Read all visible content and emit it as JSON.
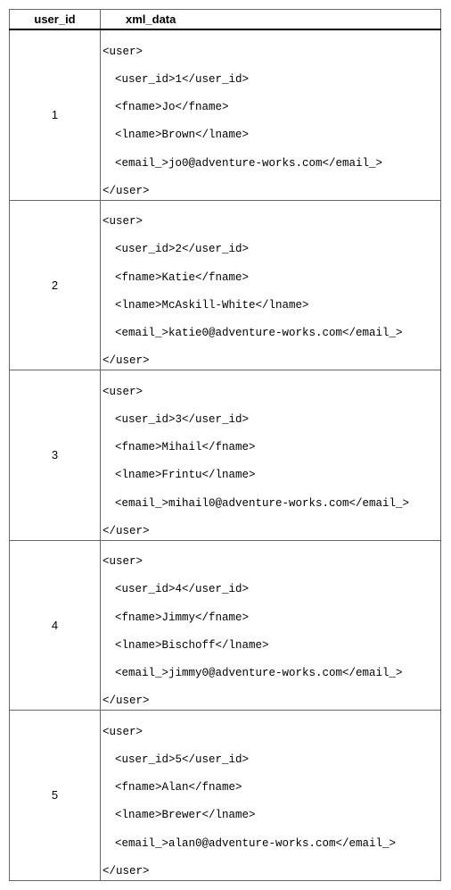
{
  "headers": {
    "user_id": "user_id",
    "xml_data": "xml_data"
  },
  "rows": [
    {
      "user_id": "1",
      "xml": {
        "open": "<user>",
        "user_id_line": "<user_id>1</user_id>",
        "fname_line": "<fname>Jo</fname>",
        "lname_line": "<lname>Brown</lname>",
        "email_line": "<email_>jo0@adventure-works.com</email_>",
        "close": "</user>"
      }
    },
    {
      "user_id": "2",
      "xml": {
        "open": "<user>",
        "user_id_line": "<user_id>2</user_id>",
        "fname_line": "<fname>Katie</fname>",
        "lname_line": "<lname>McAskill-White</lname>",
        "email_line": "<email_>katie0@adventure-works.com</email_>",
        "close": "</user>"
      }
    },
    {
      "user_id": "3",
      "xml": {
        "open": "<user>",
        "user_id_line": "<user_id>3</user_id>",
        "fname_line": "<fname>Mihail</fname>",
        "lname_line": "<lname>Frintu</lname>",
        "email_line": "<email_>mihail0@adventure-works.com</email_>",
        "close": "</user>"
      }
    },
    {
      "user_id": "4",
      "xml": {
        "open": "<user>",
        "user_id_line": "<user_id>4</user_id>",
        "fname_line": "<fname>Jimmy</fname>",
        "lname_line": "<lname>Bischoff</lname>",
        "email_line": "<email_>jimmy0@adventure-works.com</email_>",
        "close": "</user>"
      }
    },
    {
      "user_id": "5",
      "xml": {
        "open": "<user>",
        "user_id_line": "<user_id>5</user_id>",
        "fname_line": "<fname>Alan</fname>",
        "lname_line": "<lname>Brewer</lname>",
        "email_line": "<email_>alan0@adventure-works.com</email_>",
        "close": "</user>"
      }
    }
  ],
  "chart_data": {
    "type": "table",
    "columns": [
      "user_id",
      "xml_data"
    ],
    "rows": [
      {
        "user_id": 1,
        "fname": "Jo",
        "lname": "Brown",
        "email": "jo0@adventure-works.com"
      },
      {
        "user_id": 2,
        "fname": "Katie",
        "lname": "McAskill-White",
        "email": "katie0@adventure-works.com"
      },
      {
        "user_id": 3,
        "fname": "Mihail",
        "lname": "Frintu",
        "email": "mihail0@adventure-works.com"
      },
      {
        "user_id": 4,
        "fname": "Jimmy",
        "lname": "Bischoff",
        "email": "jimmy0@adventure-works.com"
      },
      {
        "user_id": 5,
        "fname": "Alan",
        "lname": "Brewer",
        "email": "alan0@adventure-works.com"
      }
    ]
  }
}
